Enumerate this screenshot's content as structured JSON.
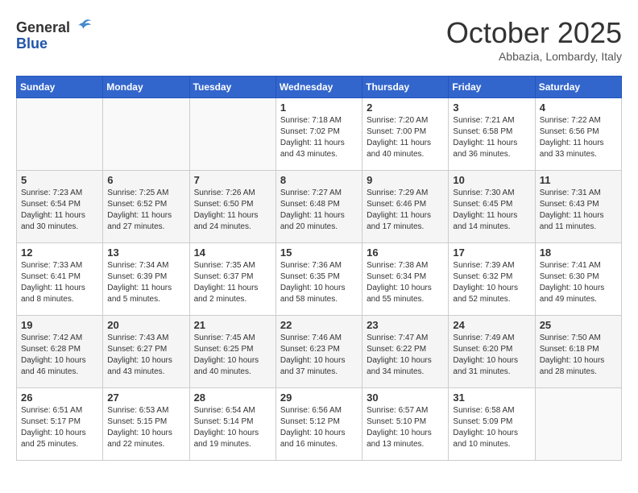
{
  "header": {
    "logo_general": "General",
    "logo_blue": "Blue",
    "month": "October 2025",
    "location": "Abbazia, Lombardy, Italy"
  },
  "weekdays": [
    "Sunday",
    "Monday",
    "Tuesday",
    "Wednesday",
    "Thursday",
    "Friday",
    "Saturday"
  ],
  "weeks": [
    [
      {
        "day": "",
        "info": ""
      },
      {
        "day": "",
        "info": ""
      },
      {
        "day": "",
        "info": ""
      },
      {
        "day": "1",
        "info": "Sunrise: 7:18 AM\nSunset: 7:02 PM\nDaylight: 11 hours\nand 43 minutes."
      },
      {
        "day": "2",
        "info": "Sunrise: 7:20 AM\nSunset: 7:00 PM\nDaylight: 11 hours\nand 40 minutes."
      },
      {
        "day": "3",
        "info": "Sunrise: 7:21 AM\nSunset: 6:58 PM\nDaylight: 11 hours\nand 36 minutes."
      },
      {
        "day": "4",
        "info": "Sunrise: 7:22 AM\nSunset: 6:56 PM\nDaylight: 11 hours\nand 33 minutes."
      }
    ],
    [
      {
        "day": "5",
        "info": "Sunrise: 7:23 AM\nSunset: 6:54 PM\nDaylight: 11 hours\nand 30 minutes."
      },
      {
        "day": "6",
        "info": "Sunrise: 7:25 AM\nSunset: 6:52 PM\nDaylight: 11 hours\nand 27 minutes."
      },
      {
        "day": "7",
        "info": "Sunrise: 7:26 AM\nSunset: 6:50 PM\nDaylight: 11 hours\nand 24 minutes."
      },
      {
        "day": "8",
        "info": "Sunrise: 7:27 AM\nSunset: 6:48 PM\nDaylight: 11 hours\nand 20 minutes."
      },
      {
        "day": "9",
        "info": "Sunrise: 7:29 AM\nSunset: 6:46 PM\nDaylight: 11 hours\nand 17 minutes."
      },
      {
        "day": "10",
        "info": "Sunrise: 7:30 AM\nSunset: 6:45 PM\nDaylight: 11 hours\nand 14 minutes."
      },
      {
        "day": "11",
        "info": "Sunrise: 7:31 AM\nSunset: 6:43 PM\nDaylight: 11 hours\nand 11 minutes."
      }
    ],
    [
      {
        "day": "12",
        "info": "Sunrise: 7:33 AM\nSunset: 6:41 PM\nDaylight: 11 hours\nand 8 minutes."
      },
      {
        "day": "13",
        "info": "Sunrise: 7:34 AM\nSunset: 6:39 PM\nDaylight: 11 hours\nand 5 minutes."
      },
      {
        "day": "14",
        "info": "Sunrise: 7:35 AM\nSunset: 6:37 PM\nDaylight: 11 hours\nand 2 minutes."
      },
      {
        "day": "15",
        "info": "Sunrise: 7:36 AM\nSunset: 6:35 PM\nDaylight: 10 hours\nand 58 minutes."
      },
      {
        "day": "16",
        "info": "Sunrise: 7:38 AM\nSunset: 6:34 PM\nDaylight: 10 hours\nand 55 minutes."
      },
      {
        "day": "17",
        "info": "Sunrise: 7:39 AM\nSunset: 6:32 PM\nDaylight: 10 hours\nand 52 minutes."
      },
      {
        "day": "18",
        "info": "Sunrise: 7:41 AM\nSunset: 6:30 PM\nDaylight: 10 hours\nand 49 minutes."
      }
    ],
    [
      {
        "day": "19",
        "info": "Sunrise: 7:42 AM\nSunset: 6:28 PM\nDaylight: 10 hours\nand 46 minutes."
      },
      {
        "day": "20",
        "info": "Sunrise: 7:43 AM\nSunset: 6:27 PM\nDaylight: 10 hours\nand 43 minutes."
      },
      {
        "day": "21",
        "info": "Sunrise: 7:45 AM\nSunset: 6:25 PM\nDaylight: 10 hours\nand 40 minutes."
      },
      {
        "day": "22",
        "info": "Sunrise: 7:46 AM\nSunset: 6:23 PM\nDaylight: 10 hours\nand 37 minutes."
      },
      {
        "day": "23",
        "info": "Sunrise: 7:47 AM\nSunset: 6:22 PM\nDaylight: 10 hours\nand 34 minutes."
      },
      {
        "day": "24",
        "info": "Sunrise: 7:49 AM\nSunset: 6:20 PM\nDaylight: 10 hours\nand 31 minutes."
      },
      {
        "day": "25",
        "info": "Sunrise: 7:50 AM\nSunset: 6:18 PM\nDaylight: 10 hours\nand 28 minutes."
      }
    ],
    [
      {
        "day": "26",
        "info": "Sunrise: 6:51 AM\nSunset: 5:17 PM\nDaylight: 10 hours\nand 25 minutes."
      },
      {
        "day": "27",
        "info": "Sunrise: 6:53 AM\nSunset: 5:15 PM\nDaylight: 10 hours\nand 22 minutes."
      },
      {
        "day": "28",
        "info": "Sunrise: 6:54 AM\nSunset: 5:14 PM\nDaylight: 10 hours\nand 19 minutes."
      },
      {
        "day": "29",
        "info": "Sunrise: 6:56 AM\nSunset: 5:12 PM\nDaylight: 10 hours\nand 16 minutes."
      },
      {
        "day": "30",
        "info": "Sunrise: 6:57 AM\nSunset: 5:10 PM\nDaylight: 10 hours\nand 13 minutes."
      },
      {
        "day": "31",
        "info": "Sunrise: 6:58 AM\nSunset: 5:09 PM\nDaylight: 10 hours\nand 10 minutes."
      },
      {
        "day": "",
        "info": ""
      }
    ]
  ]
}
